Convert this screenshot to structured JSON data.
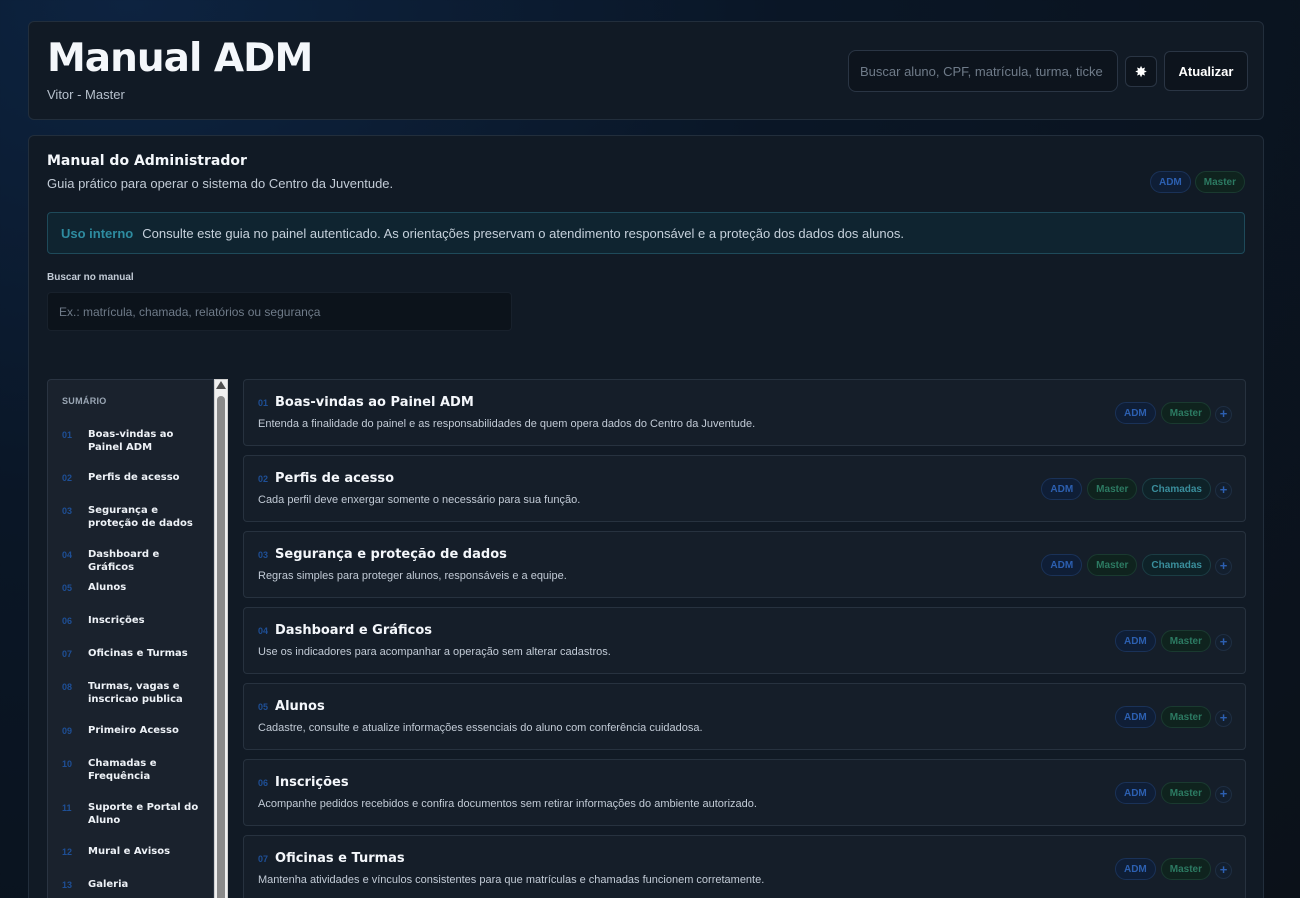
{
  "header": {
    "title": "Manual ADM",
    "subtitle": "Vitor - Master",
    "search_placeholder": "Buscar aluno, CPF, matrícula, turma, ticke",
    "theme_icon": "✸",
    "refresh_label": "Atualizar"
  },
  "manual": {
    "title": "Manual do Administrador",
    "subtitle": "Guia prático para operar o sistema do Centro da Juventude.",
    "badges": [
      "ADM",
      "Master"
    ],
    "notice_tag": "Uso interno",
    "notice_text": "Consulte este guia no painel autenticado. As orientações preservam o atendimento responsável e a proteção dos dados dos alunos.",
    "search_label": "Buscar no manual",
    "search_placeholder": "Ex.: matrícula, chamada, relatórios ou segurança"
  },
  "toc": {
    "heading": "SUMÁRIO",
    "items": [
      {
        "num": "01",
        "label": "Boas-vindas ao Painel ADM"
      },
      {
        "num": "02",
        "label": "Perfis de acesso"
      },
      {
        "num": "03",
        "label": "Segurança e proteção de dados"
      },
      {
        "num": "04",
        "label": "Dashboard e Gráficos"
      },
      {
        "num": "05",
        "label": "Alunos"
      },
      {
        "num": "06",
        "label": "Inscrições"
      },
      {
        "num": "07",
        "label": "Oficinas e Turmas"
      },
      {
        "num": "08",
        "label": "Turmas, vagas e inscricao publica"
      },
      {
        "num": "09",
        "label": "Primeiro Acesso"
      },
      {
        "num": "10",
        "label": "Chamadas e Frequência"
      },
      {
        "num": "11",
        "label": "Suporte e Portal do Aluno"
      },
      {
        "num": "12",
        "label": "Mural e Avisos"
      },
      {
        "num": "13",
        "label": "Galeria"
      }
    ]
  },
  "sections": [
    {
      "num": "01",
      "title": "Boas-vindas ao Painel ADM",
      "desc": "Entenda a finalidade do painel e as responsabilidades de quem opera dados do Centro da Juventude.",
      "badges": [
        "ADM",
        "Master"
      ],
      "expand": "+"
    },
    {
      "num": "02",
      "title": "Perfis de acesso",
      "desc": "Cada perfil deve enxergar somente o necessário para sua função.",
      "badges": [
        "ADM",
        "Master",
        "Chamadas"
      ],
      "expand": "+"
    },
    {
      "num": "03",
      "title": "Segurança e proteção de dados",
      "desc": "Regras simples para proteger alunos, responsáveis e a equipe.",
      "badges": [
        "ADM",
        "Master",
        "Chamadas"
      ],
      "expand": "+"
    },
    {
      "num": "04",
      "title": "Dashboard e Gráficos",
      "desc": "Use os indicadores para acompanhar a operação sem alterar cadastros.",
      "badges": [
        "ADM",
        "Master"
      ],
      "expand": "+"
    },
    {
      "num": "05",
      "title": "Alunos",
      "desc": "Cadastre, consulte e atualize informações essenciais do aluno com conferência cuidadosa.",
      "badges": [
        "ADM",
        "Master"
      ],
      "expand": "+"
    },
    {
      "num": "06",
      "title": "Inscrições",
      "desc": "Acompanhe pedidos recebidos e confira documentos sem retirar informações do ambiente autorizado.",
      "badges": [
        "ADM",
        "Master"
      ],
      "expand": "+"
    },
    {
      "num": "07",
      "title": "Oficinas e Turmas",
      "desc": "Mantenha atividades e vínculos consistentes para que matrículas e chamadas funcionem corretamente.",
      "badges": [
        "ADM",
        "Master"
      ],
      "expand": "+"
    }
  ]
}
